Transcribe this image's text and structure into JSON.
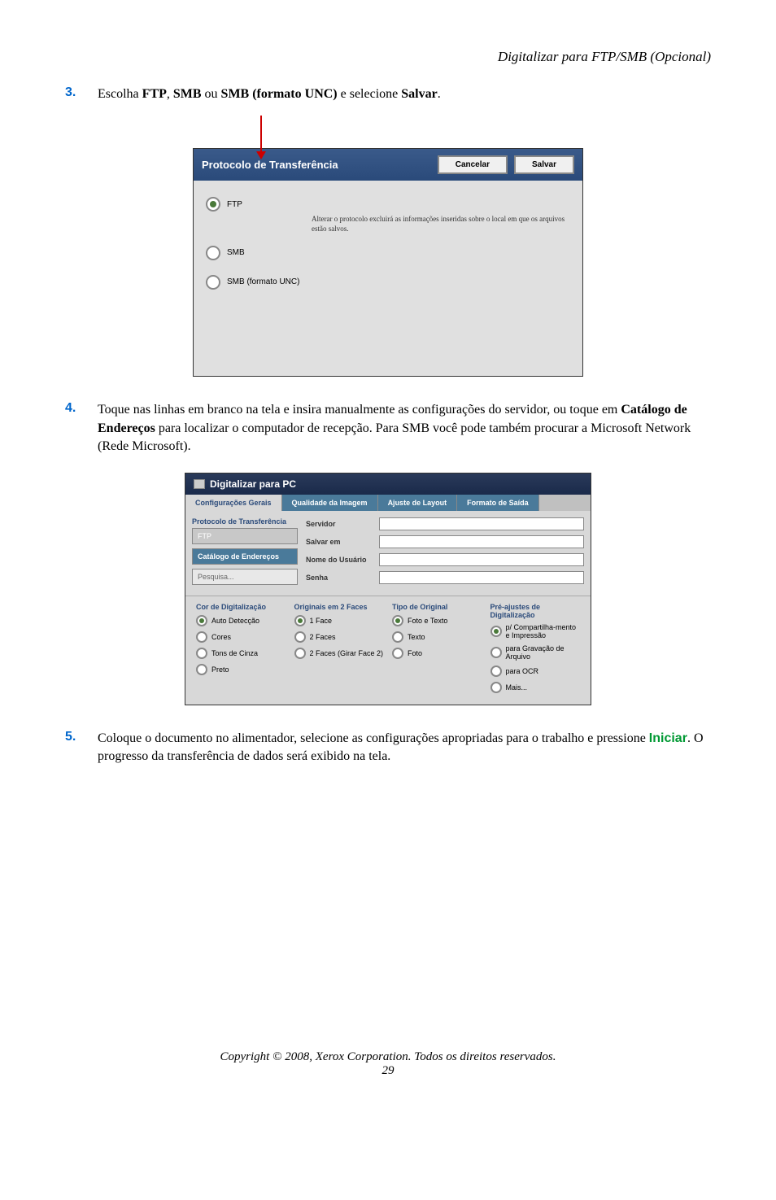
{
  "header": {
    "title": "Digitalizar para FTP/SMB (Opcional)"
  },
  "step3": {
    "num": "3.",
    "pre": "Escolha ",
    "b1": "FTP",
    "mid1": ", ",
    "b2": "SMB",
    "mid2": " ou ",
    "b3": "SMB (formato UNC)",
    "mid3": " e selecione ",
    "b4": "Salvar",
    "post": "."
  },
  "dialog1": {
    "title": "Protocolo de Transferência",
    "cancel": "Cancelar",
    "save": "Salvar",
    "opt1": "FTP",
    "desc": "Alterar o protocolo excluirá as informações inseridas sobre o local em que os arquivos estão salvos.",
    "opt2": "SMB",
    "opt3": "SMB (formato UNC)"
  },
  "step4": {
    "num": "4.",
    "pre": "Toque nas linhas em branco na tela e insira manualmente as configurações do servidor, ou toque em ",
    "b1": "Catálogo de Endereços",
    "post": " para localizar o computador de recepção. Para SMB você pode também procurar a Microsoft Network (Rede Microsoft)."
  },
  "dialog2": {
    "title": "Digitalizar para PC",
    "tab1": "Configurações Gerais",
    "tab2": "Qualidade da Imagem",
    "tab3": "Ajuste de Layout",
    "tab4": "Formato de Saída",
    "proto_label": "Protocolo de Transferência",
    "ftp": "FTP",
    "catalogo": "Catálogo de Endereços",
    "pesquisa": "Pesquisa...",
    "f_servidor": "Servidor",
    "f_salvar": "Salvar em",
    "f_nome": "Nome do Usuário",
    "f_senha": "Senha",
    "col1_title": "Cor de Digitalização",
    "col1_o1": "Auto Detecção",
    "col1_o2": "Cores",
    "col1_o3": "Tons de Cinza",
    "col1_o4": "Preto",
    "col2_title": "Originais em 2 Faces",
    "col2_o1": "1 Face",
    "col2_o2": "2 Faces",
    "col2_o3": "2 Faces (Girar Face 2)",
    "col3_title": "Tipo de Original",
    "col3_o1": "Foto e Texto",
    "col3_o2": "Texto",
    "col3_o3": "Foto",
    "col4_title": "Pré-ajustes de Digitalização",
    "col4_o1": "p/ Compartilha-mento e Impressão",
    "col4_o2": "para Gravação de Arquivo",
    "col4_o3": "para OCR",
    "col4_o4": "Mais..."
  },
  "step5": {
    "num": "5.",
    "pre": "Coloque o documento no alimentador, selecione as configurações apropriadas para o trabalho e pressione ",
    "iniciar": "Iniciar",
    "post": ". O progresso da transferência de dados será exibido na tela."
  },
  "footer": {
    "copyright": "Copyright © 2008, Xerox Corporation. Todos os direitos reservados.",
    "page": "29"
  }
}
